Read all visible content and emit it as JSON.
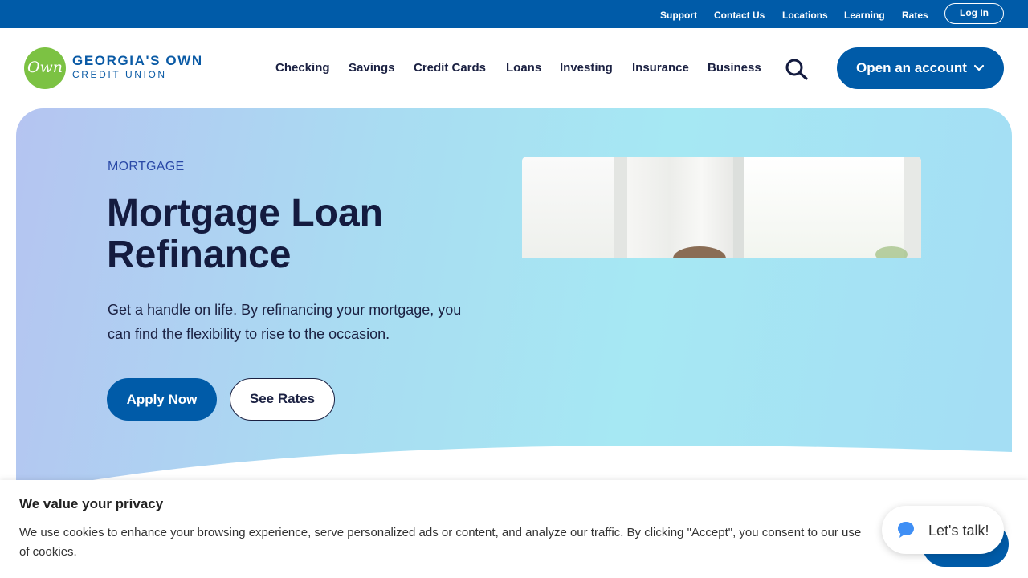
{
  "utility_nav": {
    "links": [
      "Support",
      "Contact Us",
      "Locations",
      "Learning",
      "Rates"
    ],
    "login": "Log In"
  },
  "brand": {
    "logo_mark": "Own",
    "name": "GEORGIA'S OWN",
    "subname": "CREDIT UNION"
  },
  "main_nav": {
    "items": [
      "Checking",
      "Savings",
      "Credit Cards",
      "Loans",
      "Investing",
      "Insurance",
      "Business"
    ],
    "open_account": "Open an account"
  },
  "hero": {
    "eyebrow": "MORTGAGE",
    "title": "Mortgage Loan Refinance",
    "body": "Get a handle on life. By refinancing your mortgage, you can find the flexibility to rise to the occasion.",
    "apply_label": "Apply Now",
    "rates_label": "See Rates"
  },
  "cookie": {
    "title": "We value your privacy",
    "text": "We use cookies to enhance your browsing experience, serve personalized ads or content, and analyze our traffic. By clicking \"Accept\", you consent to our use of cookies."
  },
  "chat": {
    "label": "Let's talk!"
  },
  "colors": {
    "brand_blue": "#005ba8",
    "logo_green": "#7cc243",
    "text_dark": "#1b2142"
  },
  "icons": [
    "search-icon",
    "chevron-down-icon",
    "chat-icon"
  ]
}
